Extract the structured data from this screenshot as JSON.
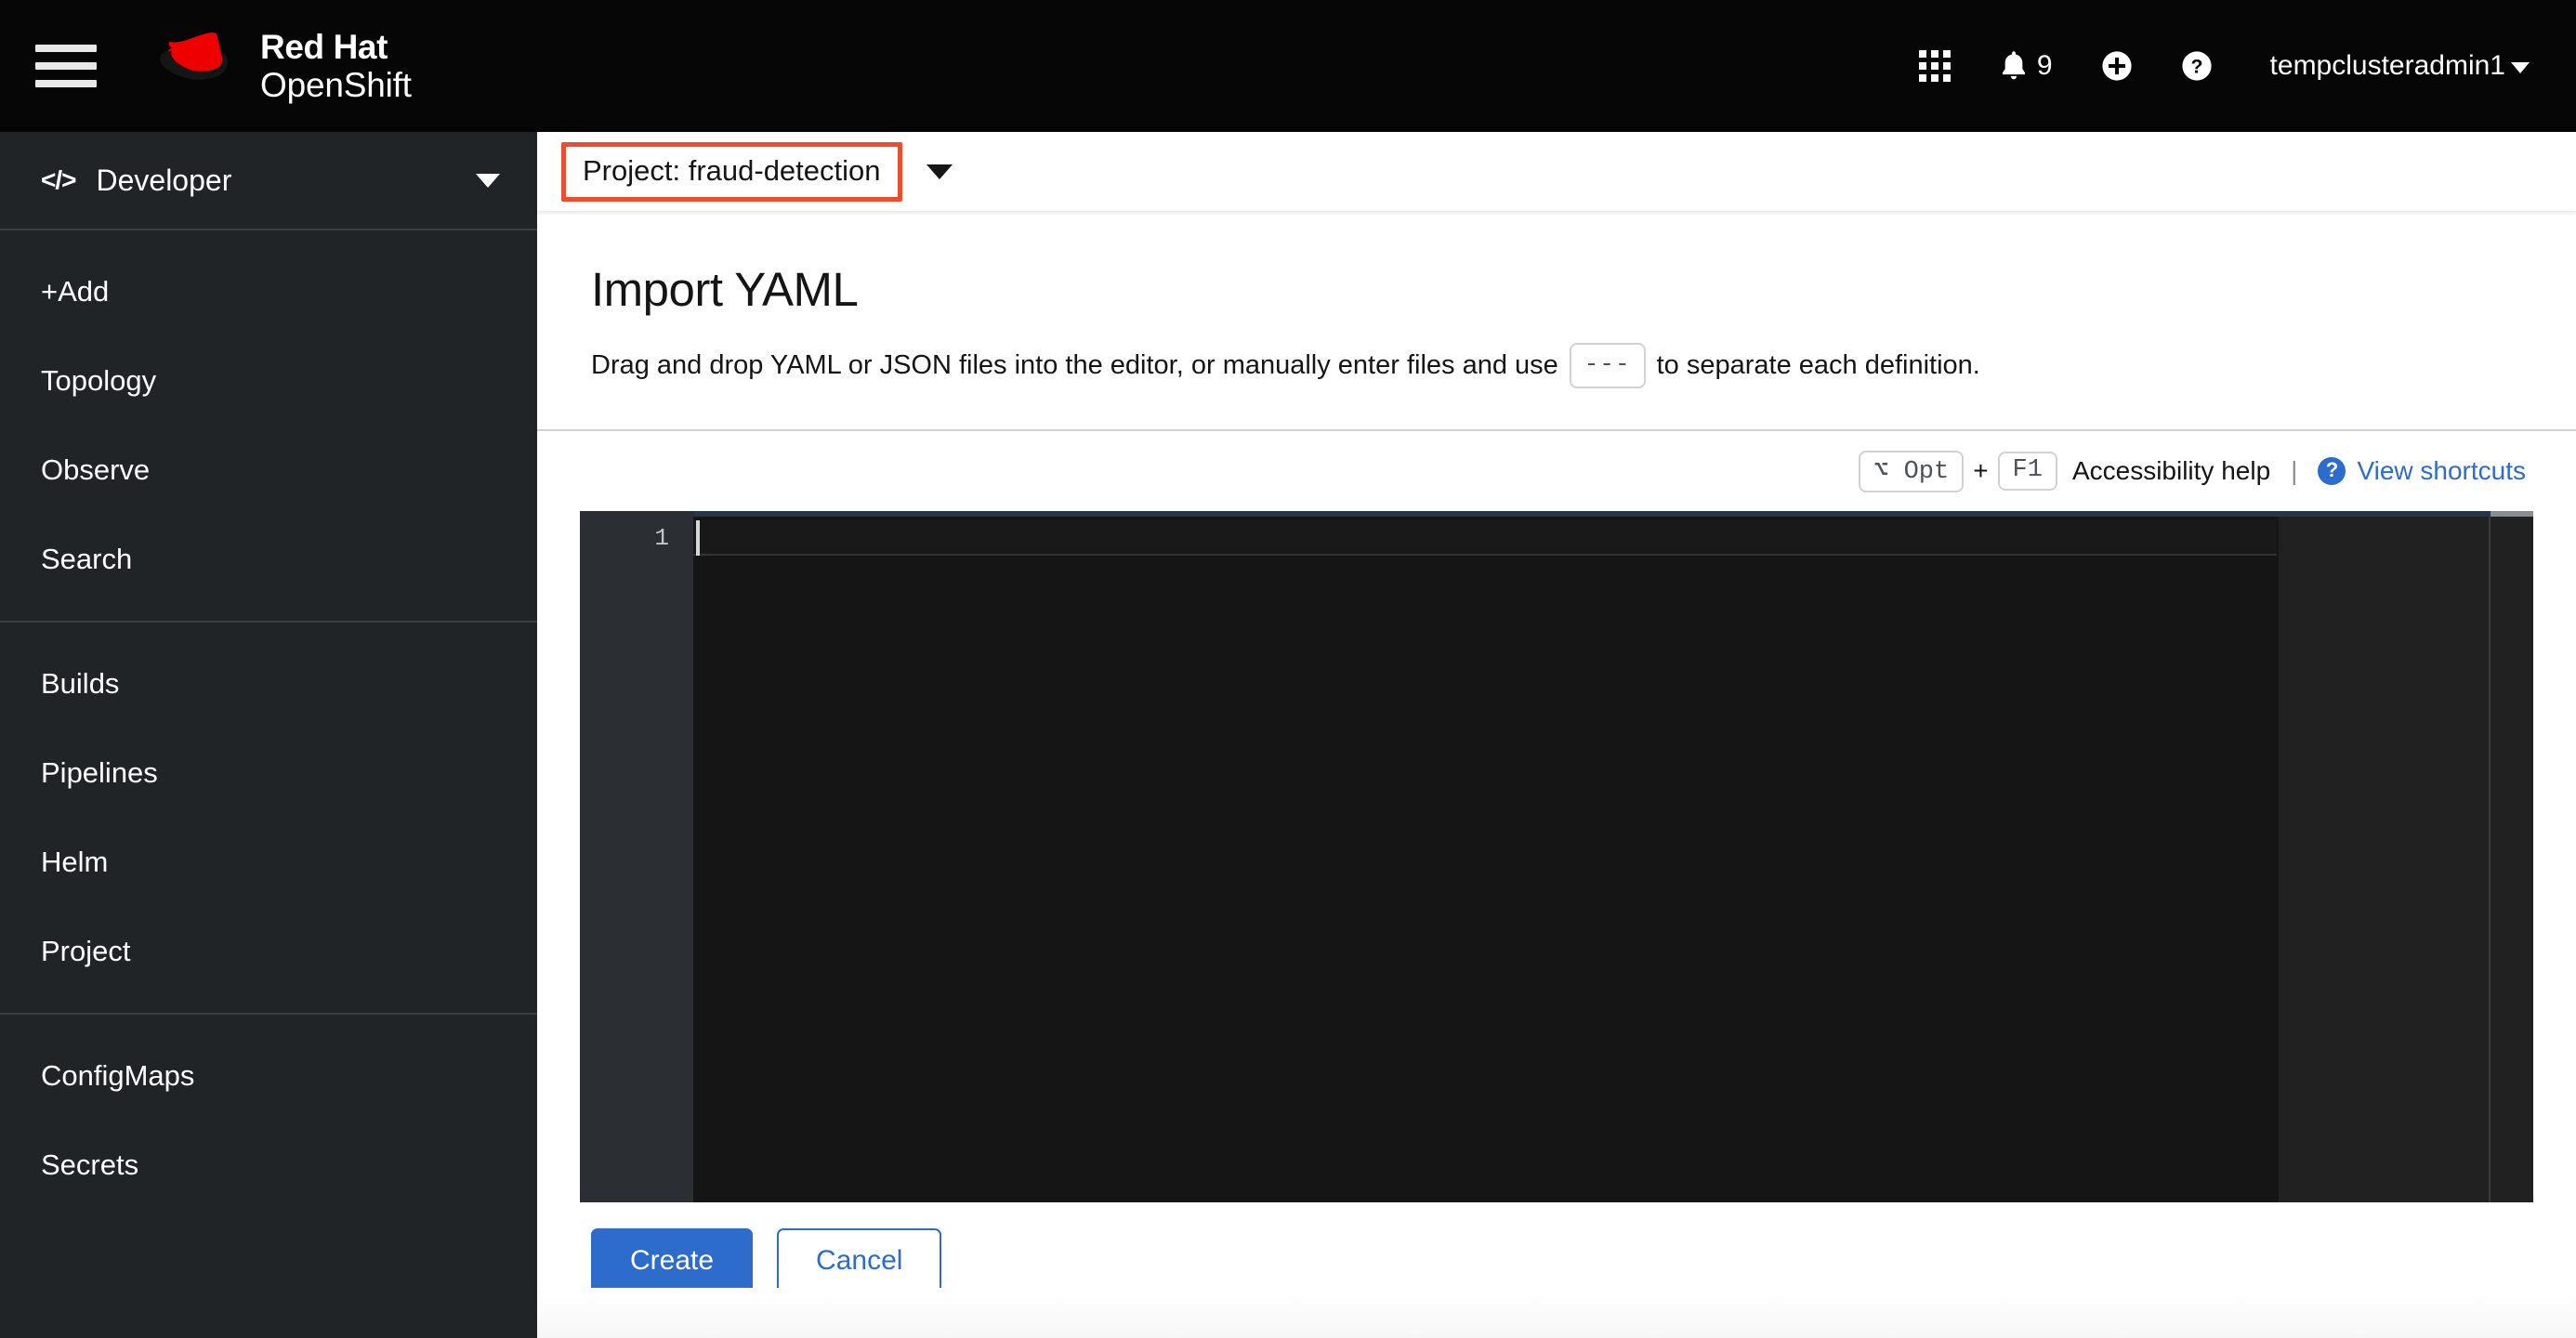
{
  "masthead": {
    "nav_toggle_name": "Global navigation toggle",
    "brand_line1": "Red Hat",
    "brand_line2": "OpenShift",
    "app_launcher_icon": "grid-icon",
    "notification_icon": "bell-icon",
    "notification_count": "9",
    "add_icon": "plus-circle-icon",
    "help_icon": "question-circle-icon",
    "username": "tempclusteradmin1",
    "user_caret": "caret-down-icon"
  },
  "sidebar": {
    "perspective": {
      "icon": "code-icon",
      "label": "Developer",
      "caret": "caret-down-icon"
    },
    "groups": [
      {
        "items": [
          {
            "label": "+Add"
          },
          {
            "label": "Topology"
          },
          {
            "label": "Observe"
          },
          {
            "label": "Search"
          }
        ]
      },
      {
        "items": [
          {
            "label": "Builds"
          },
          {
            "label": "Pipelines"
          },
          {
            "label": "Helm"
          },
          {
            "label": "Project"
          }
        ]
      },
      {
        "items": [
          {
            "label": "ConfigMaps"
          },
          {
            "label": "Secrets"
          }
        ]
      }
    ]
  },
  "project_bar": {
    "selector_label": "Project: fraud-detection",
    "caret": "caret-down-icon",
    "highlight_color": "#ee4c2c"
  },
  "page": {
    "title": "Import YAML",
    "description_before": "Drag and drop YAML or JSON files into the editor, or manually enter files and use",
    "description_chip": "---",
    "description_after": "to separate each definition."
  },
  "editor": {
    "toolbar": {
      "key_modifier": "⌥ Opt",
      "key_joiner": "+",
      "key_secondary": "F1",
      "accessibility_text": "Accessibility help",
      "separator": "|",
      "help_icon": "question-circle-icon",
      "shortcuts_link": "View shortcuts"
    },
    "line_numbers": [
      "1"
    ],
    "content": "",
    "theme_background": "#151515",
    "gutter_background": "#2b2f34"
  },
  "footer": {
    "create_label": "Create",
    "cancel_label": "Cancel",
    "primary_color": "#2e6ccc"
  }
}
